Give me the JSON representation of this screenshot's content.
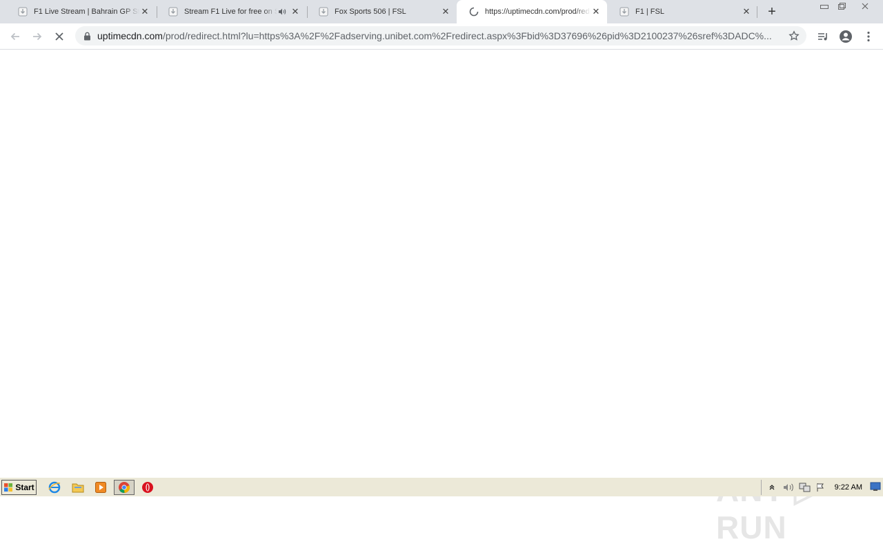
{
  "tabs": [
    {
      "title": "F1 Live Stream | Bahrain GP Stream",
      "active": false,
      "audio": false,
      "loading": false
    },
    {
      "title": "Stream F1 Live for free on SportsLive",
      "active": false,
      "audio": true,
      "loading": false
    },
    {
      "title": "Fox Sports 506 | FSL",
      "active": false,
      "audio": false,
      "loading": false
    },
    {
      "title": "https://uptimecdn.com/prod/redirect.html",
      "active": true,
      "audio": false,
      "loading": true
    },
    {
      "title": "F1 | FSL",
      "active": false,
      "audio": false,
      "loading": false
    }
  ],
  "newtab_label": "+",
  "omnibox": {
    "host": "uptimecdn.com",
    "path": "/prod/redirect.html?lu=https%3A%2F%2Fadserving.unibet.com%2Fredirect.aspx%3Fbid%3D37696%26pid%3D2100237%26sref%3DADC%..."
  },
  "watermark": "ANY ▷ RUN",
  "taskbar": {
    "start_label": "Start",
    "clock": "9:22 AM"
  },
  "colors": {
    "tabstrip": "#dee1e6",
    "active_tab": "#ffffff",
    "taskbar": "#ece9d8"
  }
}
